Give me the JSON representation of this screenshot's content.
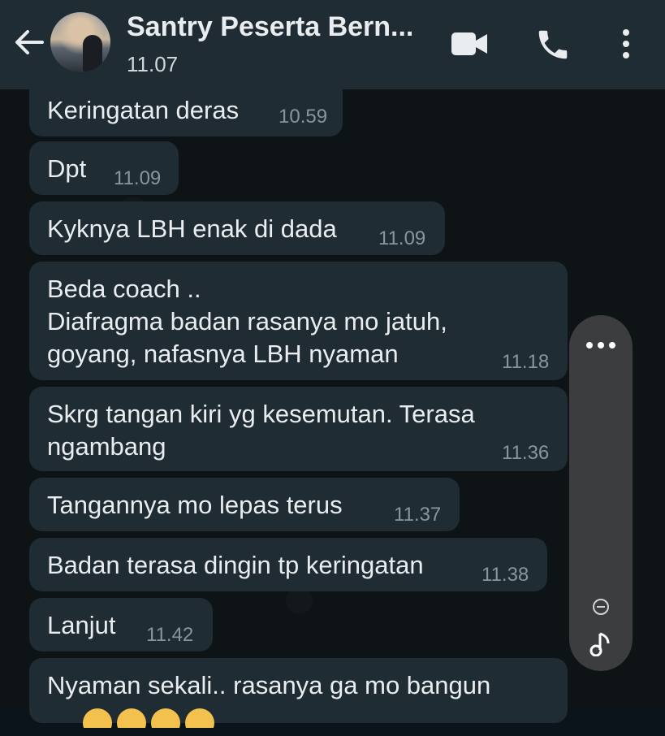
{
  "header": {
    "contact_name": "Santry Peserta Bern...",
    "last_seen": "11.07"
  },
  "messages": [
    {
      "text": "Keringatan deras",
      "time": "10.59"
    },
    {
      "text": "Dpt",
      "time": "11.09"
    },
    {
      "text": "Kyknya LBH enak di dada",
      "time": "11.09"
    },
    {
      "text": "Beda coach ..\nDiafragma badan rasanya mo jatuh,\ngoyang, nafasnya LBH nyaman",
      "time": "11.18"
    },
    {
      "text": "Skrg tangan kiri yg kesemutan. Terasa\nngambang",
      "time": "11.36"
    },
    {
      "text": "Tangannya mo lepas terus",
      "time": "11.37"
    },
    {
      "text": "Badan terasa dingin tp keringatan",
      "time": "11.38"
    },
    {
      "text": "Lanjut",
      "time": "11.42"
    },
    {
      "text": "Nyaman sekali.. rasanya ga mo bangun",
      "time": ""
    }
  ],
  "icons": {
    "back": "arrow-left-icon",
    "video": "video-camera-icon",
    "call": "phone-icon",
    "menu": "more-vertical-icon",
    "panel_more": "more-horizontal-icon",
    "panel_minus": "minus-circle-icon",
    "panel_music": "music-note-icon"
  },
  "colors": {
    "header": "#1f2c33",
    "bubble": "#1f2c34",
    "timestamp": "#8696a0",
    "text": "#e9edef"
  }
}
